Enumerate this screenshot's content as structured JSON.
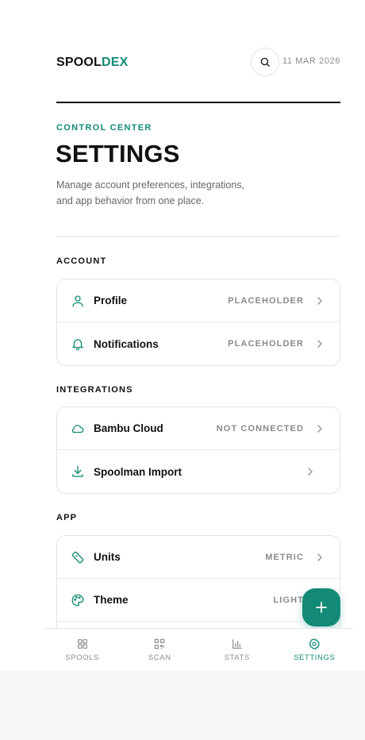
{
  "app": {
    "logo_part1": "SPOOL",
    "logo_part2": "DEX",
    "date": "11 MAR 2026"
  },
  "page": {
    "eyebrow": "CONTROL CENTER",
    "title": "SETTINGS",
    "description": "Manage account preferences, integrations, and app behavior from one place."
  },
  "sections": {
    "account": {
      "label": "ACCOUNT",
      "items": [
        {
          "label": "Profile",
          "value": "PLACEHOLDER",
          "icon": "user-icon"
        },
        {
          "label": "Notifications",
          "value": "PLACEHOLDER",
          "icon": "bell-icon"
        }
      ]
    },
    "integrations": {
      "label": "INTEGRATIONS",
      "items": [
        {
          "label": "Bambu Cloud",
          "value": "NOT CONNECTED",
          "icon": "cloud-icon"
        },
        {
          "label": "Spoolman Import",
          "value": "",
          "icon": "download-icon"
        }
      ]
    },
    "app": {
      "label": "APP",
      "items": [
        {
          "label": "Units",
          "value": "METRIC",
          "icon": "ruler-icon"
        },
        {
          "label": "Theme",
          "value": "LIGHT",
          "icon": "palette-icon"
        }
      ]
    }
  },
  "tabs": [
    {
      "label": "SPOOLS",
      "icon": "grid-icon"
    },
    {
      "label": "SCAN",
      "icon": "qr-icon"
    },
    {
      "label": "STATS",
      "icon": "bar-chart-icon"
    },
    {
      "label": "SETTINGS",
      "icon": "gear-icon",
      "active": true
    }
  ],
  "colors": {
    "accent": "#138a76",
    "text": "#111111",
    "muted": "#8a8a8a"
  }
}
